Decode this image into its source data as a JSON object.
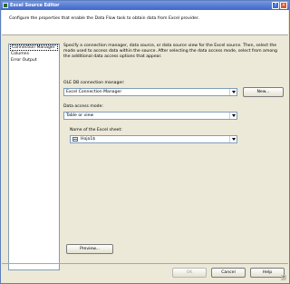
{
  "window": {
    "title": "Excel Source Editor",
    "help_glyph": "?",
    "close_glyph": "✕"
  },
  "header": {
    "text": "Configure the properties that enable the Data Flow task to obtain data from Excel provider."
  },
  "nav": {
    "items": [
      {
        "label": "Connection Manager",
        "active": true
      },
      {
        "label": "Columns",
        "active": false
      },
      {
        "label": "Error Output",
        "active": false
      }
    ]
  },
  "main": {
    "description": "Specify a connection manager, data source, or data source view for the Excel source. Then, select the mode used to access data within the source. After selecting the data access mode, select from among the additional data access options that appear.",
    "connection": {
      "label": "OLE DB connection manager:",
      "value": "Excel Connection Manager",
      "new_button": "New..."
    },
    "access_mode": {
      "label": "Data access mode:",
      "value": "Table or view"
    },
    "sheet": {
      "label": "Name of the Excel sheet:",
      "value": "Hoja1$"
    },
    "preview_button": "Preview..."
  },
  "footer": {
    "ok": "OK",
    "cancel": "Cancel",
    "help": "Help"
  }
}
